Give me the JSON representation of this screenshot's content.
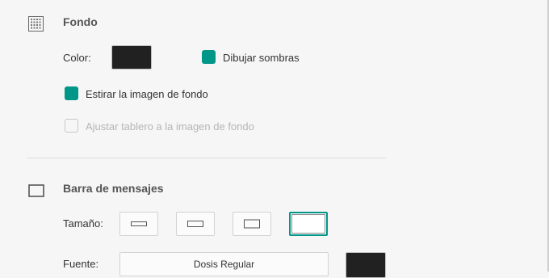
{
  "background_section": {
    "title": "Fondo",
    "icon": "grid-icon",
    "color_label": "Color:",
    "color_value": "#212121",
    "shadows_label": "Dibujar sombras",
    "shadows_checked": true,
    "stretch_label": "Estirar la imagen de fondo",
    "stretch_checked": true,
    "fit_board_label": "Ajustar tablero a la imagen de fondo",
    "fit_board_checked": false,
    "fit_board_disabled": true
  },
  "message_bar_section": {
    "title": "Barra de mensajes",
    "icon": "square-outline-icon",
    "size_label": "Tamaño:",
    "size_options": [
      "small",
      "medium",
      "large",
      "extra-large"
    ],
    "selected_size": "extra-large",
    "font_label": "Fuente:",
    "font_value": "Dosis Regular",
    "font_color": "#212121"
  },
  "colors": {
    "accent": "#009688",
    "swatch": "#212121"
  }
}
